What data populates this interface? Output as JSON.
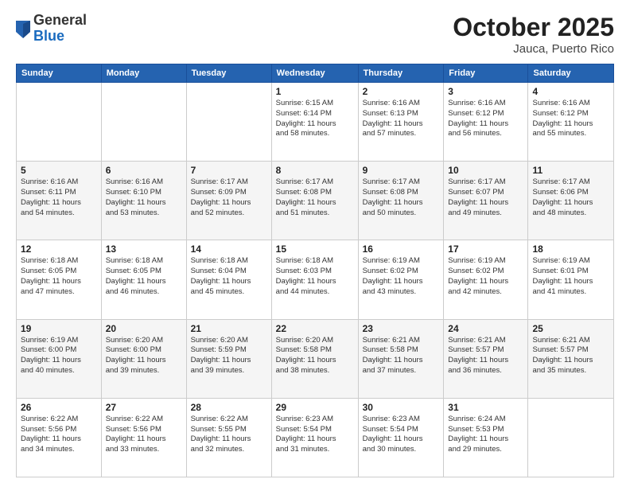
{
  "logo": {
    "general": "General",
    "blue": "Blue"
  },
  "header": {
    "month": "October 2025",
    "location": "Jauca, Puerto Rico"
  },
  "weekdays": [
    "Sunday",
    "Monday",
    "Tuesday",
    "Wednesday",
    "Thursday",
    "Friday",
    "Saturday"
  ],
  "weeks": [
    [
      {
        "date": "",
        "info": ""
      },
      {
        "date": "",
        "info": ""
      },
      {
        "date": "",
        "info": ""
      },
      {
        "date": "1",
        "info": "Sunrise: 6:15 AM\nSunset: 6:14 PM\nDaylight: 11 hours\nand 58 minutes."
      },
      {
        "date": "2",
        "info": "Sunrise: 6:16 AM\nSunset: 6:13 PM\nDaylight: 11 hours\nand 57 minutes."
      },
      {
        "date": "3",
        "info": "Sunrise: 6:16 AM\nSunset: 6:12 PM\nDaylight: 11 hours\nand 56 minutes."
      },
      {
        "date": "4",
        "info": "Sunrise: 6:16 AM\nSunset: 6:12 PM\nDaylight: 11 hours\nand 55 minutes."
      }
    ],
    [
      {
        "date": "5",
        "info": "Sunrise: 6:16 AM\nSunset: 6:11 PM\nDaylight: 11 hours\nand 54 minutes."
      },
      {
        "date": "6",
        "info": "Sunrise: 6:16 AM\nSunset: 6:10 PM\nDaylight: 11 hours\nand 53 minutes."
      },
      {
        "date": "7",
        "info": "Sunrise: 6:17 AM\nSunset: 6:09 PM\nDaylight: 11 hours\nand 52 minutes."
      },
      {
        "date": "8",
        "info": "Sunrise: 6:17 AM\nSunset: 6:08 PM\nDaylight: 11 hours\nand 51 minutes."
      },
      {
        "date": "9",
        "info": "Sunrise: 6:17 AM\nSunset: 6:08 PM\nDaylight: 11 hours\nand 50 minutes."
      },
      {
        "date": "10",
        "info": "Sunrise: 6:17 AM\nSunset: 6:07 PM\nDaylight: 11 hours\nand 49 minutes."
      },
      {
        "date": "11",
        "info": "Sunrise: 6:17 AM\nSunset: 6:06 PM\nDaylight: 11 hours\nand 48 minutes."
      }
    ],
    [
      {
        "date": "12",
        "info": "Sunrise: 6:18 AM\nSunset: 6:05 PM\nDaylight: 11 hours\nand 47 minutes."
      },
      {
        "date": "13",
        "info": "Sunrise: 6:18 AM\nSunset: 6:05 PM\nDaylight: 11 hours\nand 46 minutes."
      },
      {
        "date": "14",
        "info": "Sunrise: 6:18 AM\nSunset: 6:04 PM\nDaylight: 11 hours\nand 45 minutes."
      },
      {
        "date": "15",
        "info": "Sunrise: 6:18 AM\nSunset: 6:03 PM\nDaylight: 11 hours\nand 44 minutes."
      },
      {
        "date": "16",
        "info": "Sunrise: 6:19 AM\nSunset: 6:02 PM\nDaylight: 11 hours\nand 43 minutes."
      },
      {
        "date": "17",
        "info": "Sunrise: 6:19 AM\nSunset: 6:02 PM\nDaylight: 11 hours\nand 42 minutes."
      },
      {
        "date": "18",
        "info": "Sunrise: 6:19 AM\nSunset: 6:01 PM\nDaylight: 11 hours\nand 41 minutes."
      }
    ],
    [
      {
        "date": "19",
        "info": "Sunrise: 6:19 AM\nSunset: 6:00 PM\nDaylight: 11 hours\nand 40 minutes."
      },
      {
        "date": "20",
        "info": "Sunrise: 6:20 AM\nSunset: 6:00 PM\nDaylight: 11 hours\nand 39 minutes."
      },
      {
        "date": "21",
        "info": "Sunrise: 6:20 AM\nSunset: 5:59 PM\nDaylight: 11 hours\nand 39 minutes."
      },
      {
        "date": "22",
        "info": "Sunrise: 6:20 AM\nSunset: 5:58 PM\nDaylight: 11 hours\nand 38 minutes."
      },
      {
        "date": "23",
        "info": "Sunrise: 6:21 AM\nSunset: 5:58 PM\nDaylight: 11 hours\nand 37 minutes."
      },
      {
        "date": "24",
        "info": "Sunrise: 6:21 AM\nSunset: 5:57 PM\nDaylight: 11 hours\nand 36 minutes."
      },
      {
        "date": "25",
        "info": "Sunrise: 6:21 AM\nSunset: 5:57 PM\nDaylight: 11 hours\nand 35 minutes."
      }
    ],
    [
      {
        "date": "26",
        "info": "Sunrise: 6:22 AM\nSunset: 5:56 PM\nDaylight: 11 hours\nand 34 minutes."
      },
      {
        "date": "27",
        "info": "Sunrise: 6:22 AM\nSunset: 5:56 PM\nDaylight: 11 hours\nand 33 minutes."
      },
      {
        "date": "28",
        "info": "Sunrise: 6:22 AM\nSunset: 5:55 PM\nDaylight: 11 hours\nand 32 minutes."
      },
      {
        "date": "29",
        "info": "Sunrise: 6:23 AM\nSunset: 5:54 PM\nDaylight: 11 hours\nand 31 minutes."
      },
      {
        "date": "30",
        "info": "Sunrise: 6:23 AM\nSunset: 5:54 PM\nDaylight: 11 hours\nand 30 minutes."
      },
      {
        "date": "31",
        "info": "Sunrise: 6:24 AM\nSunset: 5:53 PM\nDaylight: 11 hours\nand 29 minutes."
      },
      {
        "date": "",
        "info": ""
      }
    ]
  ]
}
